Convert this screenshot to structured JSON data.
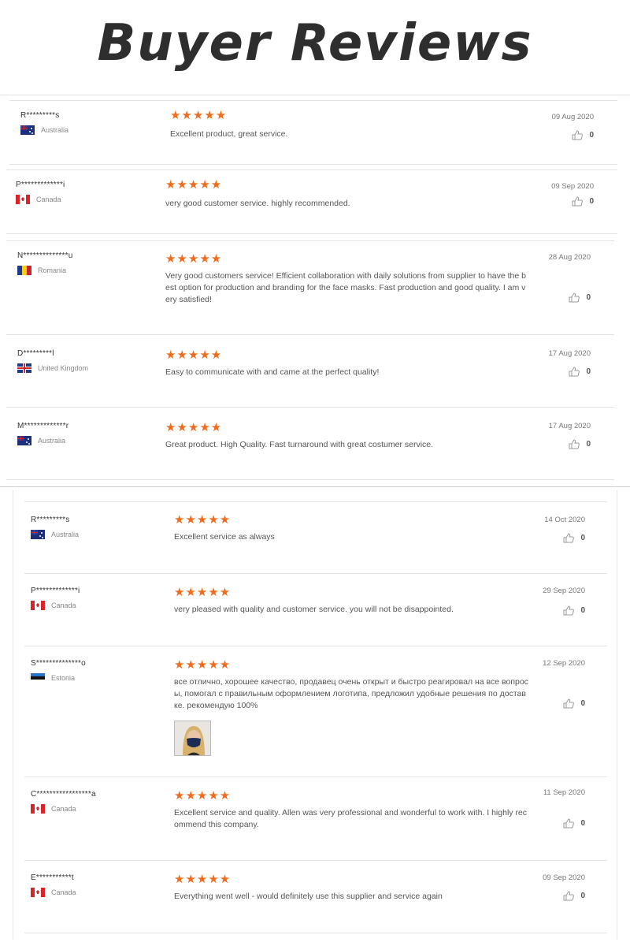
{
  "page": {
    "title": "Buyer Reviews"
  },
  "reviews": [
    {
      "buyer": "R*********s",
      "country": "Australia",
      "flag": "au",
      "stars": "★★★★★",
      "text": "Excellent product, great service.",
      "date": "09 Aug 2020",
      "likes": "0"
    },
    {
      "buyer": "P*************i",
      "country": "Canada",
      "flag": "ca",
      "stars": "★★★★★",
      "text": "very good customer service. highly recommended.",
      "date": "09 Sep 2020",
      "likes": "0"
    },
    {
      "buyer": "N**************u",
      "country": "Romania",
      "flag": "ro",
      "stars": "★★★★★",
      "text": "Very good customers service! Efficient collaboration with daily solutions from supplier to have the best option for production and branding for the face masks. Fast production and good quality. I am very satisfied!",
      "date": "28 Aug 2020",
      "likes": "0"
    },
    {
      "buyer": "D*********l",
      "country": "United Kingdom",
      "flag": "uk",
      "stars": "★★★★★",
      "text": "Easy to communicate with and came at the perfect quality!",
      "date": "17 Aug 2020",
      "likes": "0"
    },
    {
      "buyer": "M*************r",
      "country": "Australia",
      "flag": "au",
      "stars": "★★★★★",
      "text": "Great product. High Quality. Fast turnaround with great costumer service.",
      "date": "17 Aug 2020",
      "likes": "0"
    },
    {
      "buyer": "R*********s",
      "country": "Australia",
      "flag": "au",
      "stars": "★★★★★",
      "text": "Excellent service as always",
      "date": "14 Oct 2020",
      "likes": "0"
    },
    {
      "buyer": "P*************i",
      "country": "Canada",
      "flag": "ca",
      "stars": "★★★★★",
      "text": "very pleased with quality and customer service. you will not be disappointed.",
      "date": "29 Sep 2020",
      "likes": "0"
    },
    {
      "buyer": "S**************o",
      "country": "Estonia",
      "flag": "ee",
      "stars": "★★★★★",
      "text": "все отлично, хорошее качество, продавец очень открыт и быстро реагировал на все вопросы, помогал с правильным оформлением логотипа, предложил удобные решения по доставке. рекомендую 100%",
      "date": "12 Sep 2020",
      "likes": "0"
    },
    {
      "buyer": "C*****************a",
      "country": "Canada",
      "flag": "ca",
      "stars": "★★★★★",
      "text": "Excellent service and quality. Allen was very professional and wonderful to work with. I highly recommend this company.",
      "date": "11 Sep 2020",
      "likes": "0"
    },
    {
      "buyer": "E***********t",
      "country": "Canada",
      "flag": "ca",
      "stars": "★★★★★",
      "text": "Everything went well - would definitely use this supplier and service again",
      "date": "09 Sep 2020",
      "likes": "0"
    }
  ],
  "colors": {
    "star": "#f06b1c",
    "title": "#2e2e2e"
  }
}
